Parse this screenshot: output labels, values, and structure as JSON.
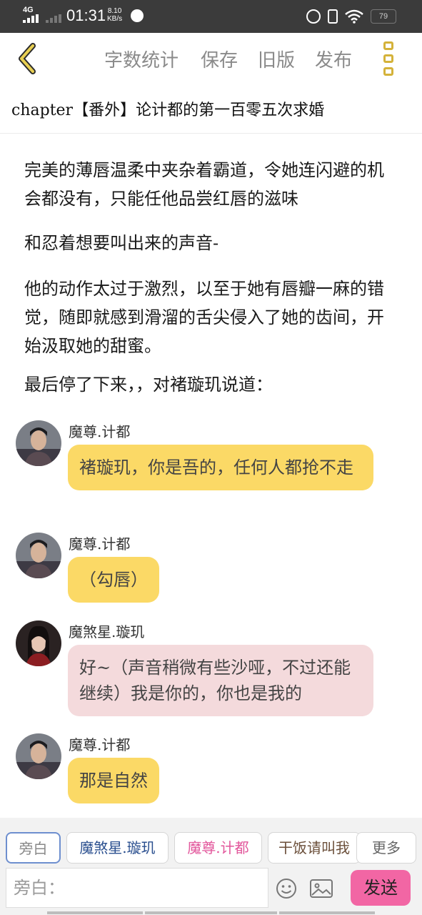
{
  "status": {
    "network": "4G",
    "time": "01:31",
    "speed_value": "8.10",
    "speed_unit": "KB/s",
    "battery": "79"
  },
  "toolbar": {
    "word_count": "字数统计",
    "save": "保存",
    "old_version": "旧版",
    "publish": "发布"
  },
  "chapter_title": "chapter【番外】论计都的第一百零五次求婚",
  "narration": [
    "完美的薄唇温柔中夹杂着霸道，令她连闪避的机会都没有，只能任他品尝红唇的滋味",
    "和忍着想要叫出来的声音-",
    "他的动作太过于激烈，以至于她有唇瓣一麻的错觉，随即就感到滑溜的舌尖侵入了她的齿间，开始汲取她的甜蜜。",
    "最后停了下来，，对褚璇玑说道："
  ],
  "messages": [
    {
      "speaker": "魔尊.计都",
      "text": "褚璇玑，你是吾的，任何人都抢不走"
    },
    {
      "speaker": "魔尊.计都",
      "text": "（勾唇）"
    },
    {
      "speaker": "魔煞星.璇玑",
      "text": "好~（声音稍微有些沙哑，不过还能继续）我是你的，你也是我的"
    },
    {
      "speaker": "魔尊.计都",
      "text": "那是自然"
    }
  ],
  "role_chips": [
    "旁白",
    "魔煞星.璇玑",
    "魔尊.计都",
    "干饭请叫我",
    "更多"
  ],
  "input_placeholder": "旁白：",
  "send_label": "发送",
  "colors": {
    "accent_yellow": "#fbd966",
    "bubble_pink": "#f4dadc",
    "send_pink": "#f266a4",
    "icon_gold": "#d4b23a"
  }
}
